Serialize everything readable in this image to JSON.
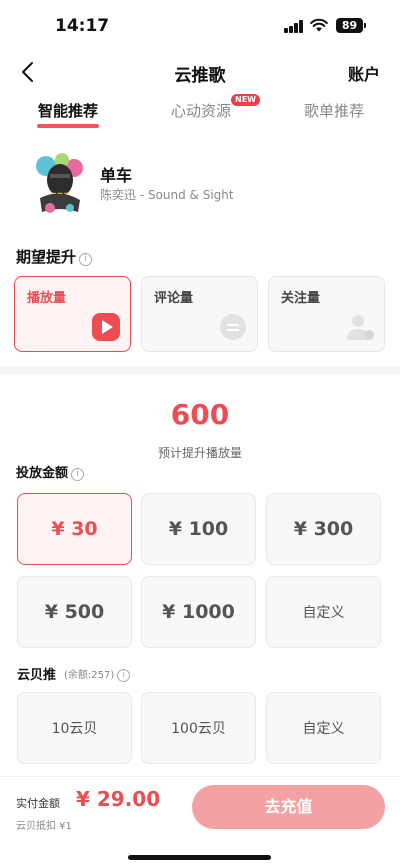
{
  "status_bar": {
    "time": "14:17",
    "battery": "89"
  },
  "nav": {
    "title": "云推歌",
    "account_label": "账户",
    "back_icon": "chevron-left-icon"
  },
  "tabs": [
    {
      "label": "智能推荐",
      "active": true
    },
    {
      "label": "心动资源",
      "badge": "NEW"
    },
    {
      "label": "歌单推荐"
    }
  ],
  "song": {
    "title": "单车",
    "artist": "陈奕迅 - Sound & Sight"
  },
  "expected_boost": {
    "label": "期望提升",
    "info_icon": "i",
    "options": [
      {
        "label": "播放量",
        "icon": "play-icon",
        "selected": true
      },
      {
        "label": "评论量",
        "icon": "comment-icon"
      },
      {
        "label": "关注量",
        "icon": "follow-icon"
      }
    ]
  },
  "estimate": {
    "value": "600",
    "caption": "预计提升播放量"
  },
  "amount": {
    "label": "投放金额",
    "info_icon": "i",
    "options": [
      {
        "label": "¥ 30",
        "selected": true
      },
      {
        "label": "¥ 100"
      },
      {
        "label": "¥ 300"
      },
      {
        "label": "¥ 500"
      },
      {
        "label": "¥ 1000"
      },
      {
        "label": "自定义"
      }
    ]
  },
  "yunbei": {
    "label": "云贝推",
    "balance": "(余额:257)",
    "info_icon": "i",
    "options": [
      {
        "label": "10云贝"
      },
      {
        "label": "100云贝"
      },
      {
        "label": "自定义"
      }
    ]
  },
  "payment": {
    "label": "实付金额",
    "amount": "¥ 29.00",
    "deduct": "云贝抵扣 ¥1",
    "button": "去充值"
  },
  "colors": {
    "accent": "#ec4d52",
    "button_disabled": "#f3a1a3"
  }
}
